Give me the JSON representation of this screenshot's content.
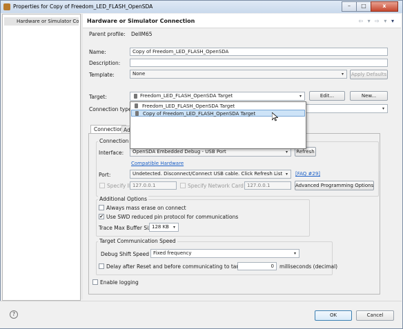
{
  "window": {
    "title": "Properties for Copy of Freedom_LED_FLASH_OpenSDA",
    "minimize": "–",
    "maximize": "□",
    "close": "x"
  },
  "left_pane": {
    "items": [
      {
        "label": "Hardware or Simulator Conr"
      }
    ]
  },
  "header": {
    "title": "Hardware or Simulator Connection",
    "nav_icons": {
      "back": "⇦ ▾",
      "forward": "⇨ ▾",
      "menu": "▾"
    }
  },
  "form": {
    "parent_profile_label": "Parent profile:",
    "parent_profile_value": "DellM65",
    "name_label": "Name:",
    "name_value": "Copy of Freedom_LED_FLASH_OpenSDA",
    "description_label": "Description:",
    "description_value": "",
    "template_label": "Template:",
    "template_value": "None",
    "apply_defaults": "Apply Defaults",
    "target_label": "Target:",
    "target_value": "Freedom_LED_FLASH_OpenSDA Target",
    "edit_button": "Edit...",
    "new_button": "New...",
    "connection_type_label": "Connection type:",
    "connection_type_value": ""
  },
  "target_dropdown": {
    "options": [
      {
        "label": "Freedom_LED_FLASH_OpenSDA Target"
      },
      {
        "label": "Copy of Freedom_LED_FLASH_OpenSDA Target"
      }
    ],
    "selected_index": 1
  },
  "tabs": [
    {
      "label": "Connection",
      "active": true
    },
    {
      "label": "Ad",
      "active": false
    }
  ],
  "connection_tab": {
    "connection_group_title": "Connection p",
    "interface_label": "Interface:",
    "interface_value": "OpenSDA Embedded Debug - USB Port",
    "refresh_button": "Refresh",
    "compatible_hardware_link": "Compatible Hardware",
    "port_label": "Port:",
    "port_value": "Undetected. Disconnect/Connect USB cable. Click Refresh List",
    "faq_link": "[FAQ #29]",
    "specify_ip_label": "Specify IP",
    "specify_ip_value": "127.0.0.1",
    "specify_nc_ip_label": "Specify Network Card IP",
    "specify_nc_ip_value": "127.0.0.1",
    "advanced_programming_button": "Advanced Programming Options",
    "additional_options_title": "Additional Options",
    "always_mass_erase_label": "Always mass erase on connect",
    "always_mass_erase_checked": false,
    "use_swd_label": "Use SWD reduced pin protocol for communications",
    "use_swd_checked": true,
    "trace_buffer_label": "Trace Max Buffer Size:",
    "trace_buffer_value": "128 KB",
    "speed_group_title": "Target Communication Speed",
    "debug_shift_label": "Debug Shift Speed  =",
    "debug_shift_value": "Fixed frequency",
    "delay_label": "Delay after Reset and before communicating to target for",
    "delay_value": "0",
    "delay_unit": "milliseconds (decimal)",
    "enable_logging_label": "Enable logging",
    "enable_logging_checked": false
  },
  "footer": {
    "help_icon": "?",
    "ok": "OK",
    "cancel": "Cancel"
  },
  "checkmark": "✔"
}
